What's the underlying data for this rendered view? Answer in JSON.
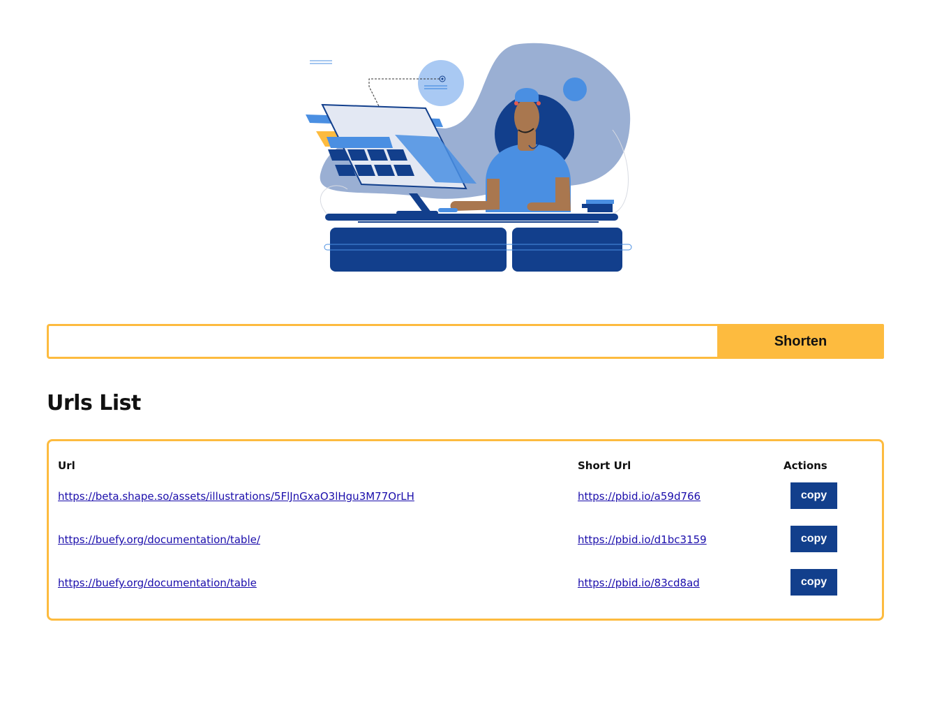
{
  "hero": {
    "icon": "illustration-person-at-desk-icon",
    "colors": {
      "blob": "#9aafd3",
      "dark_blue": "#123f8c",
      "mid_blue": "#4a8fe2",
      "light_blue": "#a9c9f3",
      "accent": "#fdbb3f",
      "skin": "#a9774f"
    }
  },
  "shorten": {
    "input_value": "",
    "input_placeholder": "",
    "button_label": "Shorten"
  },
  "urls_list": {
    "title": "Urls List",
    "headers": {
      "url": "Url",
      "short_url": "Short Url",
      "actions": "Actions"
    },
    "rows": [
      {
        "url": "https://beta.shape.so/assets/illustrations/5FlJnGxaO3lHgu3M77OrLH",
        "short_url": "https://pbid.io/a59d766",
        "action_label": "copy"
      },
      {
        "url": "https://buefy.org/documentation/table/",
        "short_url": "https://pbid.io/d1bc3159",
        "action_label": "copy"
      },
      {
        "url": "https://buefy.org/documentation/table",
        "short_url": "https://pbid.io/83cd8ad",
        "action_label": "copy"
      }
    ]
  },
  "colors": {
    "accent": "#fdbb3f",
    "button_blue": "#123f8c",
    "link": "#1a0dab"
  }
}
